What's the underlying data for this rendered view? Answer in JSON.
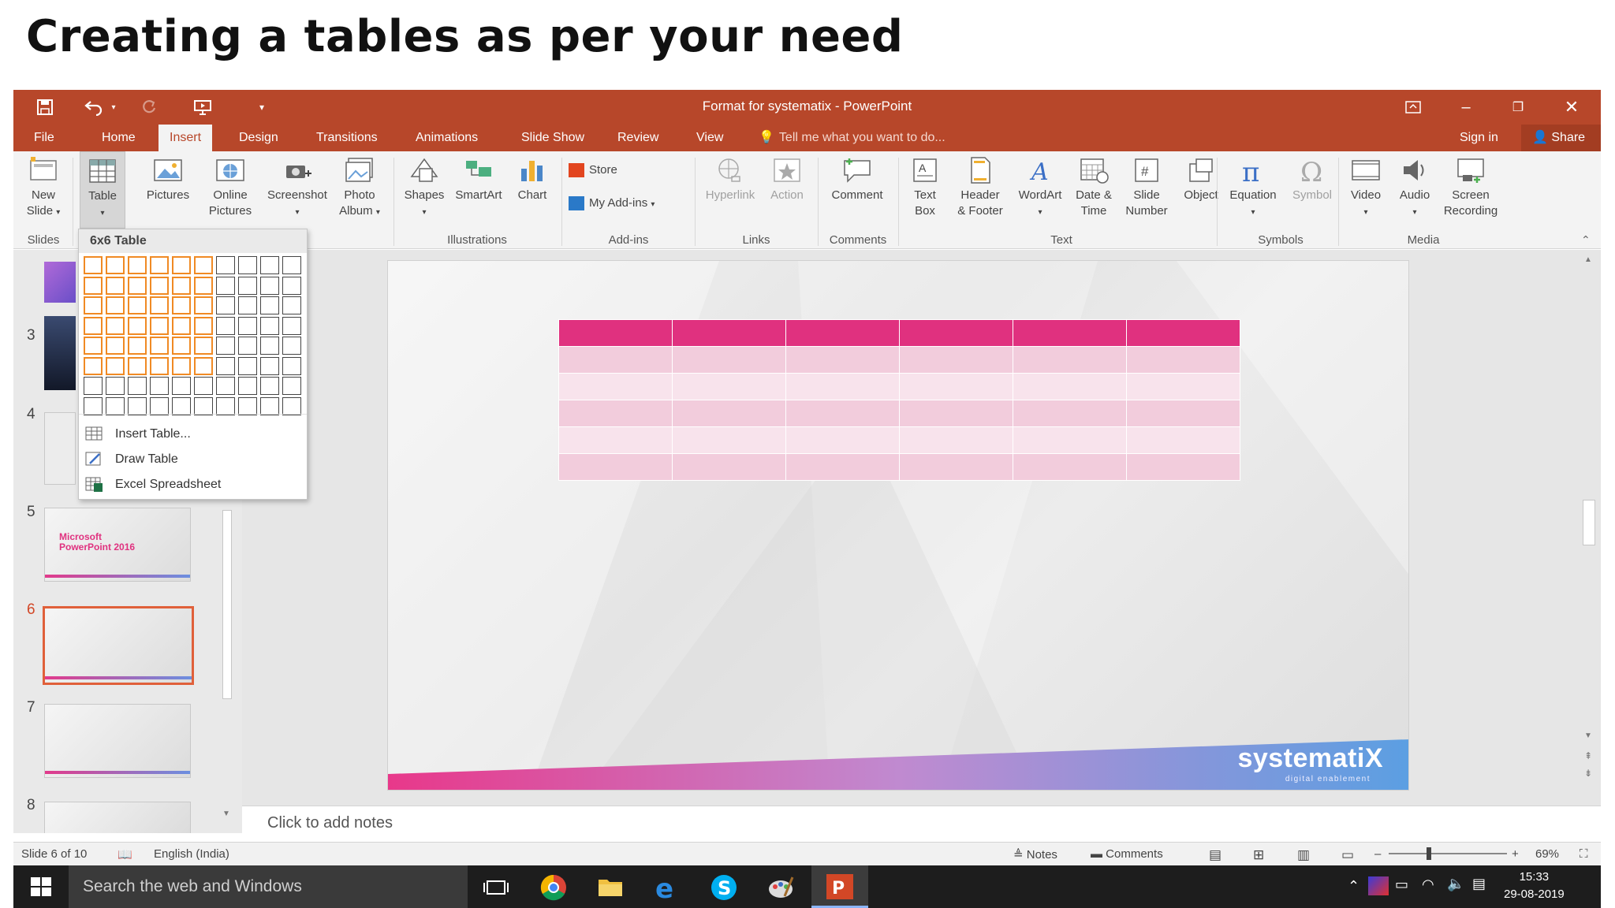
{
  "heading": "Creating a tables as per your need",
  "window": {
    "title": "Format for systematix - PowerPoint",
    "tabs": [
      "File",
      "Home",
      "Insert",
      "Design",
      "Transitions",
      "Animations",
      "Slide Show",
      "Review",
      "View"
    ],
    "active_tab": "Insert",
    "tell_me": "Tell me what you want to do...",
    "sign_in": "Sign in",
    "share": "Share"
  },
  "ribbon": {
    "new_slide": [
      "New",
      "Slide"
    ],
    "table": "Table",
    "pictures": "Pictures",
    "online_pictures": [
      "Online",
      "Pictures"
    ],
    "screenshot": "Screenshot",
    "photo_album": [
      "Photo",
      "Album"
    ],
    "shapes": "Shapes",
    "smartart": "SmartArt",
    "chart": "Chart",
    "store": "Store",
    "my_addins": "My Add-ins",
    "hyperlink": "Hyperlink",
    "action": "Action",
    "comment": "Comment",
    "text_box": [
      "Text",
      "Box"
    ],
    "header_footer": [
      "Header",
      "& Footer"
    ],
    "wordart": "WordArt",
    "date_time": [
      "Date &",
      "Time"
    ],
    "slide_number": [
      "Slide",
      "Number"
    ],
    "object": "Object",
    "equation": "Equation",
    "symbol": "Symbol",
    "video": "Video",
    "audio": "Audio",
    "screen_recording": [
      "Screen",
      "Recording"
    ],
    "groups": {
      "slides": "Slides",
      "illustrations": "Illustrations",
      "addins": "Add-ins",
      "links": "Links",
      "comments": "Comments",
      "text": "Text",
      "symbols": "Symbols",
      "media": "Media"
    }
  },
  "table_dropdown": {
    "header": "6x6 Table",
    "grid_cols": 10,
    "grid_rows": 8,
    "selected_cols": 6,
    "selected_rows": 6,
    "items": [
      "Insert Table...",
      "Draw Table",
      "Excel Spreadsheet"
    ]
  },
  "thumbnails": {
    "numbers": [
      "3",
      "4",
      "5",
      "6",
      "7",
      "8"
    ],
    "slide5_text": [
      "Microsoft",
      "PowerPoint 2016"
    ],
    "active": "6"
  },
  "slide": {
    "table_rows": 6,
    "table_cols": 6,
    "brand": "systematiX",
    "brand_sub": "digital enablement"
  },
  "notes_placeholder": "Click to add notes",
  "status": {
    "slide_of": "Slide 6 of 10",
    "language": "English (India)",
    "notes": "Notes",
    "comments": "Comments",
    "zoom": "69%"
  },
  "taskbar": {
    "search": "Search the web and Windows",
    "time": "15:33",
    "date": "29-08-2019"
  },
  "colors": {
    "ppt_accent": "#b7472a",
    "table_header": "#e0317f",
    "table_band_a": "#f2ccdc",
    "table_band_b": "#f8e3ec",
    "grid_highlight": "#f08a24"
  }
}
